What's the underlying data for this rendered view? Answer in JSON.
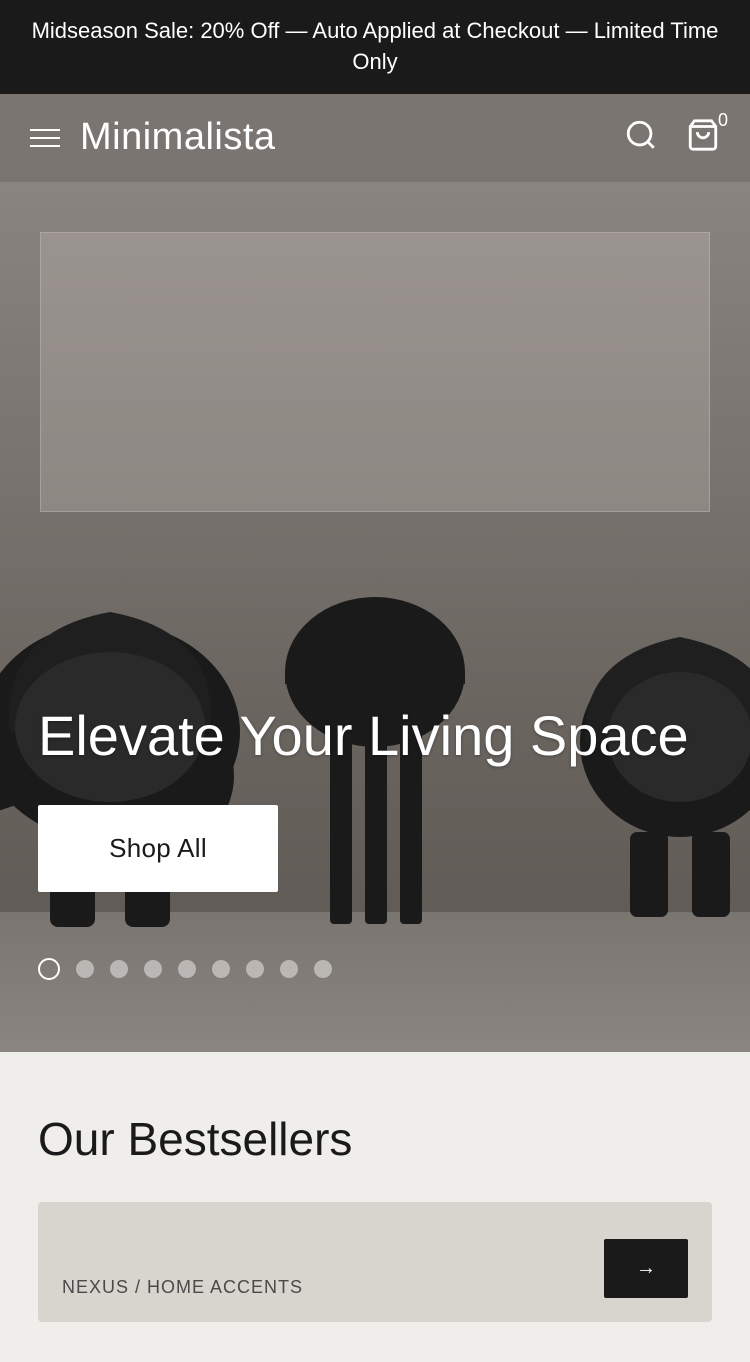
{
  "announcement": {
    "text": "Midseason Sale: 20% Off — Auto Applied at Checkout — Limited Time Only"
  },
  "header": {
    "brand": "Minimalista",
    "cart_count": "0"
  },
  "hero": {
    "title": "Elevate Your Living Space",
    "shop_all_label": "Shop All",
    "dots_count": 9,
    "active_dot": 0
  },
  "bestsellers": {
    "title": "Our Bestsellers",
    "product_label": "NEXUS / HOME ACCENTS",
    "nav_button": "→"
  }
}
